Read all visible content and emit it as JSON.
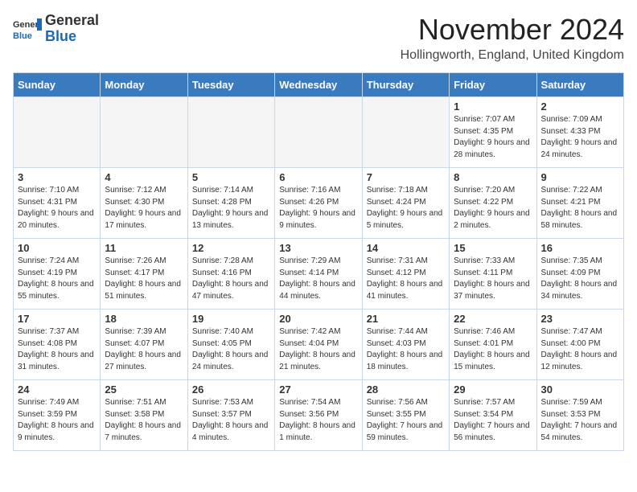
{
  "header": {
    "logo_general": "General",
    "logo_blue": "Blue",
    "month_title": "November 2024",
    "location": "Hollingworth, England, United Kingdom"
  },
  "days_of_week": [
    "Sunday",
    "Monday",
    "Tuesday",
    "Wednesday",
    "Thursday",
    "Friday",
    "Saturday"
  ],
  "weeks": [
    [
      {
        "day": "",
        "detail": ""
      },
      {
        "day": "",
        "detail": ""
      },
      {
        "day": "",
        "detail": ""
      },
      {
        "day": "",
        "detail": ""
      },
      {
        "day": "",
        "detail": ""
      },
      {
        "day": "1",
        "detail": "Sunrise: 7:07 AM\nSunset: 4:35 PM\nDaylight: 9 hours and 28 minutes."
      },
      {
        "day": "2",
        "detail": "Sunrise: 7:09 AM\nSunset: 4:33 PM\nDaylight: 9 hours and 24 minutes."
      }
    ],
    [
      {
        "day": "3",
        "detail": "Sunrise: 7:10 AM\nSunset: 4:31 PM\nDaylight: 9 hours and 20 minutes."
      },
      {
        "day": "4",
        "detail": "Sunrise: 7:12 AM\nSunset: 4:30 PM\nDaylight: 9 hours and 17 minutes."
      },
      {
        "day": "5",
        "detail": "Sunrise: 7:14 AM\nSunset: 4:28 PM\nDaylight: 9 hours and 13 minutes."
      },
      {
        "day": "6",
        "detail": "Sunrise: 7:16 AM\nSunset: 4:26 PM\nDaylight: 9 hours and 9 minutes."
      },
      {
        "day": "7",
        "detail": "Sunrise: 7:18 AM\nSunset: 4:24 PM\nDaylight: 9 hours and 5 minutes."
      },
      {
        "day": "8",
        "detail": "Sunrise: 7:20 AM\nSunset: 4:22 PM\nDaylight: 9 hours and 2 minutes."
      },
      {
        "day": "9",
        "detail": "Sunrise: 7:22 AM\nSunset: 4:21 PM\nDaylight: 8 hours and 58 minutes."
      }
    ],
    [
      {
        "day": "10",
        "detail": "Sunrise: 7:24 AM\nSunset: 4:19 PM\nDaylight: 8 hours and 55 minutes."
      },
      {
        "day": "11",
        "detail": "Sunrise: 7:26 AM\nSunset: 4:17 PM\nDaylight: 8 hours and 51 minutes."
      },
      {
        "day": "12",
        "detail": "Sunrise: 7:28 AM\nSunset: 4:16 PM\nDaylight: 8 hours and 47 minutes."
      },
      {
        "day": "13",
        "detail": "Sunrise: 7:29 AM\nSunset: 4:14 PM\nDaylight: 8 hours and 44 minutes."
      },
      {
        "day": "14",
        "detail": "Sunrise: 7:31 AM\nSunset: 4:12 PM\nDaylight: 8 hours and 41 minutes."
      },
      {
        "day": "15",
        "detail": "Sunrise: 7:33 AM\nSunset: 4:11 PM\nDaylight: 8 hours and 37 minutes."
      },
      {
        "day": "16",
        "detail": "Sunrise: 7:35 AM\nSunset: 4:09 PM\nDaylight: 8 hours and 34 minutes."
      }
    ],
    [
      {
        "day": "17",
        "detail": "Sunrise: 7:37 AM\nSunset: 4:08 PM\nDaylight: 8 hours and 31 minutes."
      },
      {
        "day": "18",
        "detail": "Sunrise: 7:39 AM\nSunset: 4:07 PM\nDaylight: 8 hours and 27 minutes."
      },
      {
        "day": "19",
        "detail": "Sunrise: 7:40 AM\nSunset: 4:05 PM\nDaylight: 8 hours and 24 minutes."
      },
      {
        "day": "20",
        "detail": "Sunrise: 7:42 AM\nSunset: 4:04 PM\nDaylight: 8 hours and 21 minutes."
      },
      {
        "day": "21",
        "detail": "Sunrise: 7:44 AM\nSunset: 4:03 PM\nDaylight: 8 hours and 18 minutes."
      },
      {
        "day": "22",
        "detail": "Sunrise: 7:46 AM\nSunset: 4:01 PM\nDaylight: 8 hours and 15 minutes."
      },
      {
        "day": "23",
        "detail": "Sunrise: 7:47 AM\nSunset: 4:00 PM\nDaylight: 8 hours and 12 minutes."
      }
    ],
    [
      {
        "day": "24",
        "detail": "Sunrise: 7:49 AM\nSunset: 3:59 PM\nDaylight: 8 hours and 9 minutes."
      },
      {
        "day": "25",
        "detail": "Sunrise: 7:51 AM\nSunset: 3:58 PM\nDaylight: 8 hours and 7 minutes."
      },
      {
        "day": "26",
        "detail": "Sunrise: 7:53 AM\nSunset: 3:57 PM\nDaylight: 8 hours and 4 minutes."
      },
      {
        "day": "27",
        "detail": "Sunrise: 7:54 AM\nSunset: 3:56 PM\nDaylight: 8 hours and 1 minute."
      },
      {
        "day": "28",
        "detail": "Sunrise: 7:56 AM\nSunset: 3:55 PM\nDaylight: 7 hours and 59 minutes."
      },
      {
        "day": "29",
        "detail": "Sunrise: 7:57 AM\nSunset: 3:54 PM\nDaylight: 7 hours and 56 minutes."
      },
      {
        "day": "30",
        "detail": "Sunrise: 7:59 AM\nSunset: 3:53 PM\nDaylight: 7 hours and 54 minutes."
      }
    ]
  ]
}
